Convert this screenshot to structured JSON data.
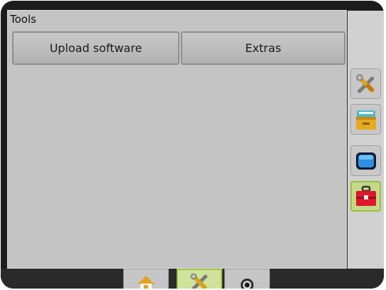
{
  "panel": {
    "title": "Tools",
    "buttons": [
      {
        "label": "Upload software"
      },
      {
        "label": "Extras"
      }
    ]
  },
  "sidebar": {
    "items": [
      {
        "icon": "wrench-screwdriver-icon"
      },
      {
        "icon": "file-box-icon"
      },
      {
        "icon": "monitor-icon"
      },
      {
        "icon": "toolbox-icon",
        "active": true
      }
    ]
  },
  "tabs": [
    {
      "icon": "home-icon"
    },
    {
      "icon": "wrench-screwdriver-icon",
      "active": true
    },
    {
      "icon": "camera-icon"
    }
  ]
}
